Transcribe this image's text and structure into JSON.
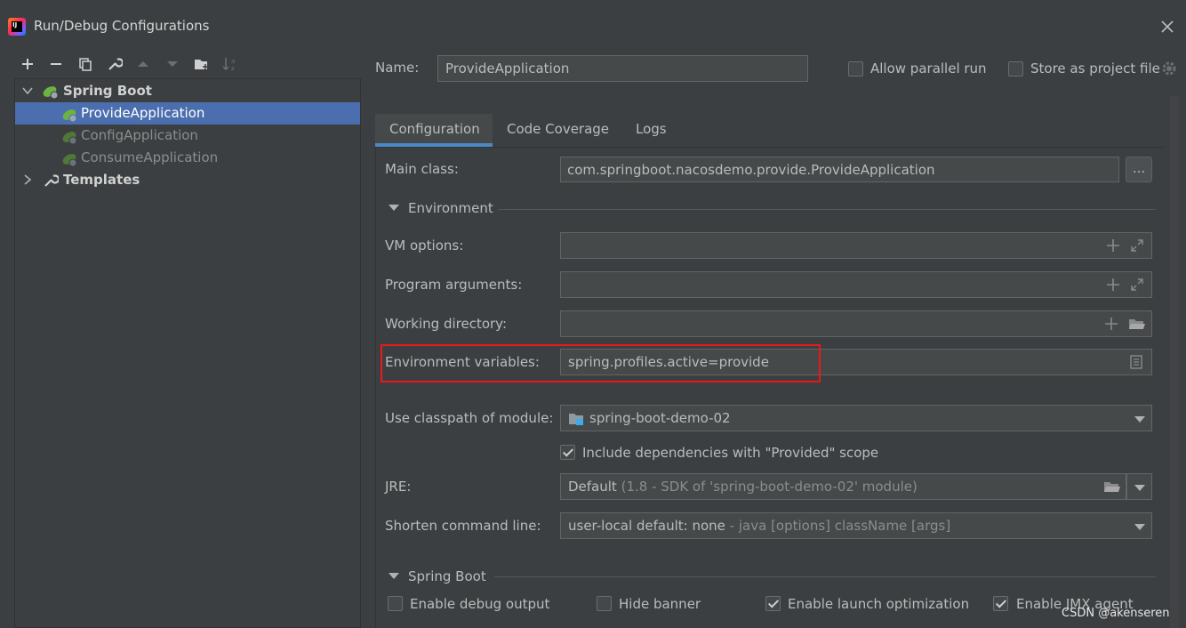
{
  "window": {
    "title": "Run/Debug Configurations"
  },
  "toolbar": {
    "icons": [
      "add-icon",
      "remove-icon",
      "copy-icon",
      "wrench-icon",
      "move-up-icon",
      "move-down-icon",
      "new-folder-icon",
      "sort-icon"
    ]
  },
  "tree": {
    "group_label": "Spring Boot",
    "items": [
      {
        "label": "ProvideApplication",
        "selected": true
      },
      {
        "label": "ConfigApplication",
        "selected": false
      },
      {
        "label": "ConsumeApplication",
        "selected": false
      }
    ],
    "templates_label": "Templates"
  },
  "header": {
    "name_label": "Name:",
    "name_value": "ProvideApplication",
    "allow_parallel_label": "Allow parallel run",
    "allow_parallel_checked": false,
    "store_project_label": "Store as project file",
    "store_project_checked": false
  },
  "tabs": [
    {
      "label": "Configuration",
      "active": true
    },
    {
      "label": "Code Coverage",
      "active": false
    },
    {
      "label": "Logs",
      "active": false
    }
  ],
  "config": {
    "main_class_label": "Main class:",
    "main_class_value": "com.springboot.nacosdemo.provide.ProvideApplication",
    "browse_label": "...",
    "environment_section": "Environment",
    "vm_options_label": "VM options:",
    "vm_options_value": "",
    "program_args_label": "Program arguments:",
    "program_args_value": "",
    "working_dir_label": "Working directory:",
    "working_dir_value": "",
    "env_vars_label": "Environment variables:",
    "env_vars_value": "spring.profiles.active=provide",
    "classpath_label": "Use classpath of module:",
    "classpath_value": "spring-boot-demo-02",
    "include_deps_label": "Include dependencies with \"Provided\" scope",
    "include_deps_checked": true,
    "jre_label": "JRE:",
    "jre_value": "Default",
    "jre_hint": "(1.8 - SDK of 'spring-boot-demo-02' module)",
    "shorten_label": "Shorten command line:",
    "shorten_value": "user-local default: none",
    "shorten_hint": "- java [options] className [args]",
    "spring_boot_section": "Spring Boot",
    "enable_debug_label": "Enable debug output",
    "enable_debug_checked": false,
    "hide_banner_label": "Hide banner",
    "hide_banner_checked": false,
    "launch_opt_label": "Enable launch optimization",
    "launch_opt_checked": true,
    "jmx_label": "Enable JMX agent",
    "jmx_checked": true
  },
  "watermark": "CSDN @akenseren",
  "colors": {
    "selection": "#4b6eaf",
    "highlight_box": "#e8191b",
    "spring_green": "#6db33f"
  }
}
